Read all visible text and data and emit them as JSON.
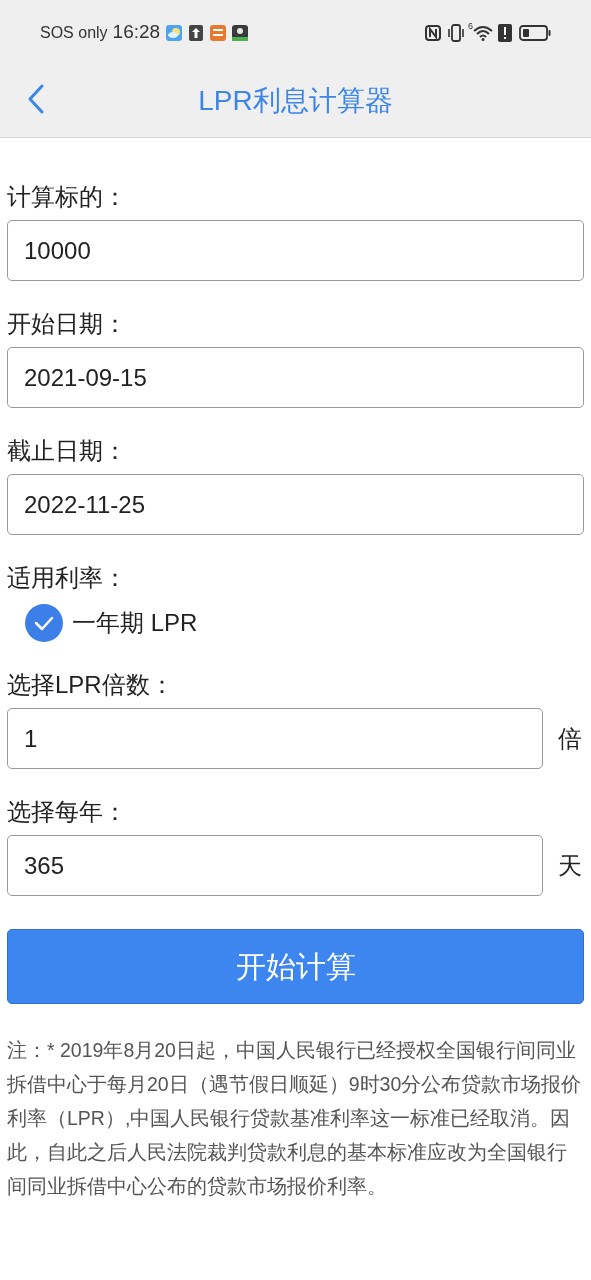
{
  "status_bar": {
    "carrier": "SOS only",
    "time": "16:28",
    "signal_label": "6"
  },
  "header": {
    "title": "LPR利息计算器"
  },
  "form": [
    {
      "kind": "field",
      "label": "计算标的：",
      "value": "10000"
    },
    {
      "kind": "field",
      "label": "开始日期：",
      "value": "2021-09-15"
    },
    {
      "kind": "field",
      "label": "截止日期：",
      "value": "2022-11-25"
    },
    {
      "kind": "checkbox",
      "label": "适用利率：",
      "option": "一年期 LPR",
      "checked": true
    },
    {
      "kind": "field",
      "label": "选择LPR倍数：",
      "value": "1",
      "unit": "倍"
    },
    {
      "kind": "field",
      "label": "选择每年：",
      "value": "365",
      "unit": "天"
    }
  ],
  "button": "开始计算",
  "note": "注：* 2019年8月20日起，中国人民银行已经授权全国银行间同业拆借中心于每月20日（遇节假日顺延）9时30分公布贷款市场报价利率（LPR）,中国人民银行贷款基准利率这一标准已经取消。因此，自此之后人民法院裁判贷款利息的基本标准应改为全国银行间同业拆借中心公布的贷款市场报价利率。"
}
